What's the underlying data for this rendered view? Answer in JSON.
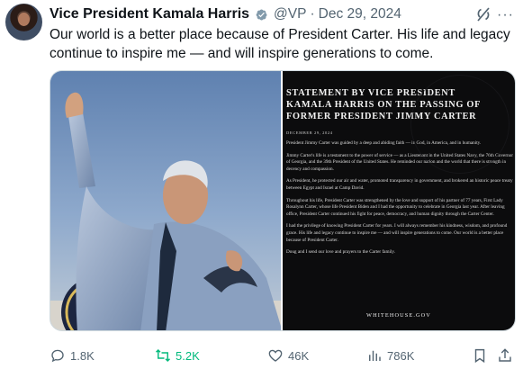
{
  "tweet": {
    "author_name": "Vice President Kamala Harris",
    "handle": "@VP",
    "separator": "·",
    "date": "Dec 29, 2024",
    "text": "Our world is a better place because of President Carter. His life and legacy continue to inspire me — and will inspire generations to come.",
    "more_label": "···"
  },
  "statement_image": {
    "title_lines": [
      "STATEMENT BY VICE PRESIDENT",
      "KAMALA HARRIS ON THE PASSING OF",
      "FORMER PRESIDENT JIMMY CARTER"
    ],
    "date": "DECEMBER 29, 2024",
    "paragraphs": [
      "President Jimmy Carter was guided by a deep and abiding faith — in God, in America, and in humanity.",
      "Jimmy Carter's life is a testament to the power of service — as a Lieutenant in the United States Navy, the 76th Governor of Georgia, and the 39th President of the United States. He reminded our nation and the world that there is strength in decency and compassion.",
      "As President, he protected our air and water, promoted transparency in government, and brokered an historic peace treaty between Egypt and Israel at Camp David.",
      "Throughout his life, President Carter was strengthened by the love and support of his partner of 77 years, First Lady Rosalynn Carter, whose life President Biden and I had the opportunity to celebrate in Georgia last year. After leaving office, President Carter continued his fight for peace, democracy, and human dignity through the Carter Center.",
      "I had the privilege of knowing President Carter for years. I will always remember his kindness, wisdom, and profound grace. His life and legacy continue to inspire me — and will inspire generations to come. Our world is a better place because of President Carter.",
      "Doug and I send our love and prayers to the Carter family."
    ],
    "footer": "WHITEHOUSE.GOV"
  },
  "actions": {
    "replies": "1.8K",
    "reposts": "5.2K",
    "likes": "46K",
    "views": "786K"
  },
  "colors": {
    "verified_badge": "#829aab",
    "repost_active": "#00ba7c",
    "secondary_text": "#536471"
  }
}
